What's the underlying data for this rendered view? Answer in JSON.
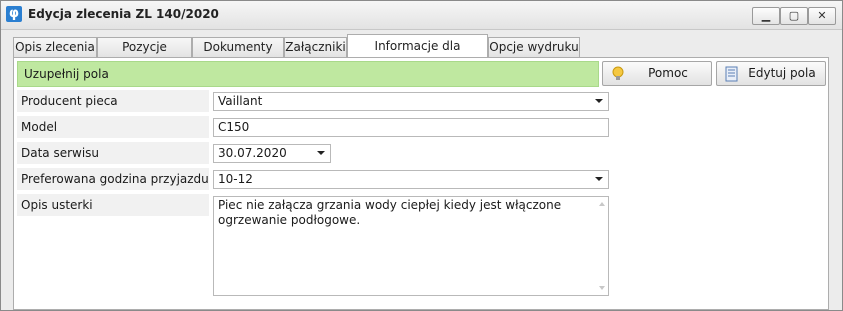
{
  "window": {
    "title": "Edycja zlecenia ZL 140/2020",
    "app_icon_glyph": "φ",
    "controls": {
      "minimize": "▁",
      "maximize": "▢",
      "close": "✕"
    }
  },
  "tabs": [
    {
      "label": "Opis zlecenia"
    },
    {
      "label": "Pozycje zlecenia"
    },
    {
      "label": "Dokumenty WZ"
    },
    {
      "label": "Załączniki"
    },
    {
      "label": "Informacje dla serwisanta",
      "active": true
    },
    {
      "label": "Opcje wydruku"
    }
  ],
  "banner": {
    "text": "Uzupełnij pola",
    "color": "#bfe8a0"
  },
  "buttons": {
    "help": {
      "label": "Pomoc",
      "icon": "lightbulb-icon"
    },
    "edit_fields": {
      "label": "Edytuj pola",
      "icon": "edit-list-icon"
    }
  },
  "form": {
    "manufacturer": {
      "label": "Producent pieca",
      "value": "Vaillant"
    },
    "model": {
      "label": "Model",
      "value": "C150"
    },
    "service_date": {
      "label": "Data serwisu",
      "value": "30.07.2020"
    },
    "preferred_time": {
      "label": "Preferowana godzina przyjazdu",
      "value": "10-12"
    },
    "fault_description": {
      "label": "Opis usterki",
      "value": "Piec nie załącza grzania wody ciepłej kiedy jest włączone ogrzewanie podłogowe."
    }
  }
}
